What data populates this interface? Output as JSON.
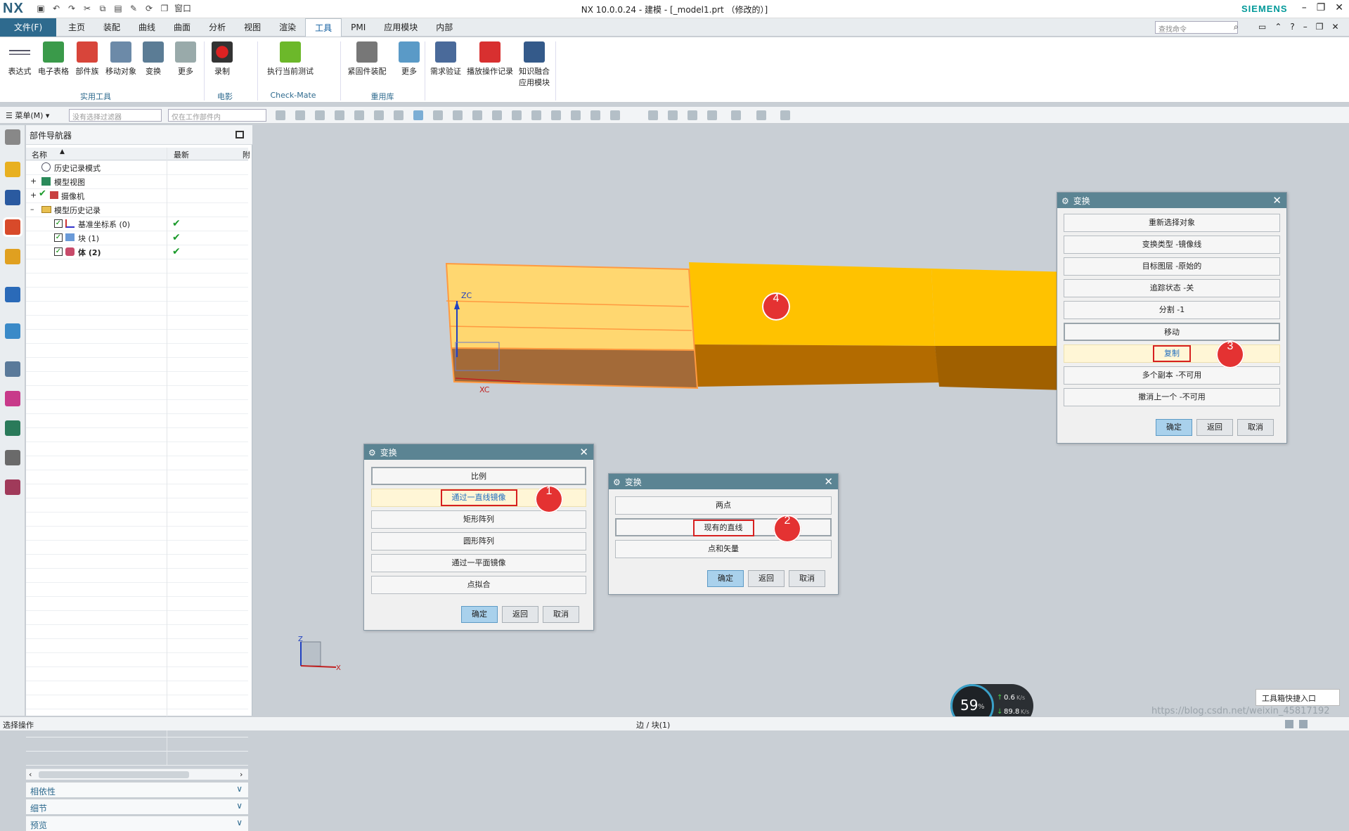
{
  "titlebar": {
    "app_logo": "NX",
    "title": "NX 10.0.0.24 - 建模 - [_model1.prt （修改的）]",
    "brand": "SIEMENS",
    "window_menu": "窗口"
  },
  "menubar": {
    "file": "文件(F)",
    "tabs": [
      "主页",
      "装配",
      "曲线",
      "曲面",
      "分析",
      "视图",
      "渲染",
      "工具",
      "PMI",
      "应用模块",
      "内部"
    ],
    "active_tab": "工具",
    "search_placeholder": "查找命令"
  },
  "ribbon": {
    "buttons": [
      "表达式",
      "电子表格",
      "部件族",
      "移动对象",
      "变换",
      "更多",
      "录制",
      "执行当前测试",
      "紧固件装配",
      "更多",
      "需求验证",
      "播放操作记录",
      "知识融合",
      "应用模块"
    ],
    "groups": [
      "实用工具",
      "电影",
      "Check-Mate",
      "重用库"
    ]
  },
  "toolbar2": {
    "menu_label": "菜单(M)",
    "filter_placeholder": "没有选择过滤器",
    "scope_placeholder": "仅在工作部件内"
  },
  "navigator": {
    "title": "部件导航器",
    "col_name": "名称",
    "col_latest": "最新",
    "col_extra": "附",
    "rows": [
      {
        "label": "历史记录模式"
      },
      {
        "label": "模型视图"
      },
      {
        "label": "摄像机"
      },
      {
        "label": "模型历史记录"
      },
      {
        "label": "基准坐标系 (0)"
      },
      {
        "label": "块 (1)"
      },
      {
        "label": "体 (2)"
      }
    ],
    "sections": [
      "相依性",
      "细节",
      "预览"
    ]
  },
  "viewport": {
    "axis_labels": {
      "zc": "ZC",
      "xc": "XC",
      "z": "Z",
      "x": "X"
    }
  },
  "dialog1": {
    "title": "变换",
    "options": [
      "比例",
      "通过一直线镜像",
      "矩形阵列",
      "圆形阵列",
      "通过一平面镜像",
      "点拟合"
    ],
    "ok": "确定",
    "back": "返回",
    "cancel": "取消"
  },
  "dialog2": {
    "title": "变换",
    "options": [
      "两点",
      "现有的直线",
      "点和矢量"
    ],
    "ok": "确定",
    "back": "返回",
    "cancel": "取消"
  },
  "dialog3": {
    "title": "变换",
    "options": [
      "重新选择对象",
      "变换类型 -镜像线",
      "目标图层 -原始的",
      "追踪状态 -关",
      "分割 -1",
      "移动",
      "复制",
      "多个副本 -不可用",
      "撤消上一个 -不可用"
    ],
    "ok": "确定",
    "back": "返回",
    "cancel": "取消"
  },
  "badges": [
    "1",
    "2",
    "3",
    "4"
  ],
  "status": {
    "left": "选择操作",
    "center": "边 / 块(1)",
    "watermark": "https://blog.csdn.net/weixin_45817192"
  },
  "netmeter": {
    "cpu_percent": "59",
    "cpu_unit": "%",
    "up": "0.6",
    "up_unit": "K/s",
    "down": "89.8",
    "down_unit": "K/s"
  },
  "toolbox": {
    "label": "工具箱快捷入口"
  },
  "colors": {
    "accent": "#2e6a8e",
    "dialog_title": "#5b8493",
    "badge": "#e43232",
    "box_top": "#ffc200",
    "box_front": "#b36b00"
  }
}
